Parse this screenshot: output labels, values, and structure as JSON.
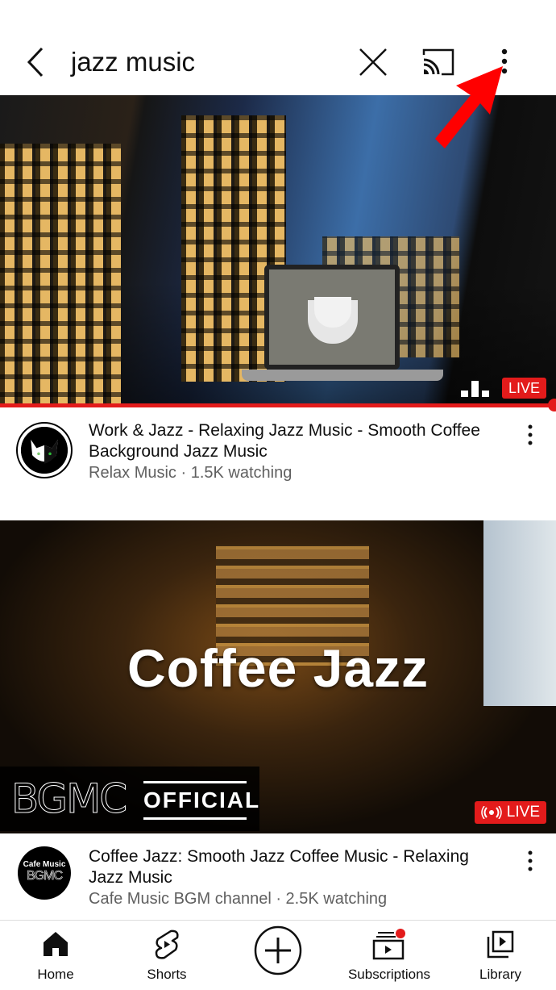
{
  "search_bar": {
    "query": "jazz music",
    "back_icon": "chevron-left-icon",
    "clear_icon": "close-icon",
    "cast_icon": "cast-icon",
    "more_icon": "more-vert-icon"
  },
  "annotation": {
    "arrow_color": "#ff0000",
    "points_to": "more-options-button"
  },
  "results": [
    {
      "title": "Work & Jazz - Relaxing Jazz Music -  Smooth Coffee Background Jazz Music",
      "channel": "Relax Music",
      "separator": " · ",
      "viewers": "1.5K watching",
      "badge": "LIVE",
      "progress_percent": 100
    },
    {
      "title": "Coffee Jazz: Smooth Jazz Coffee Music - Relaxing Jazz Music",
      "channel": "Cafe Music BGM channel",
      "separator": " · ",
      "viewers": "2.5K watching",
      "badge": "LIVE",
      "thumbnail_title": "Coffee Jazz",
      "thumbnail_logo": "BGMC",
      "thumbnail_logo_tag": "OFFICIAL",
      "avatar_text_top": "Cafe Music",
      "avatar_text_bottom": "BGMC"
    }
  ],
  "bottom_nav": [
    {
      "label": "Home",
      "icon": "home-icon",
      "active": true
    },
    {
      "label": "Shorts",
      "icon": "shorts-icon"
    },
    {
      "label": "",
      "icon": "create-plus-icon"
    },
    {
      "label": "Subscriptions",
      "icon": "subscriptions-icon",
      "has_notification_dot": true
    },
    {
      "label": "Library",
      "icon": "library-icon"
    }
  ],
  "colors": {
    "accent_red": "#e31b1b",
    "secondary_text": "#606060",
    "primary_text": "#0f0f0f"
  }
}
